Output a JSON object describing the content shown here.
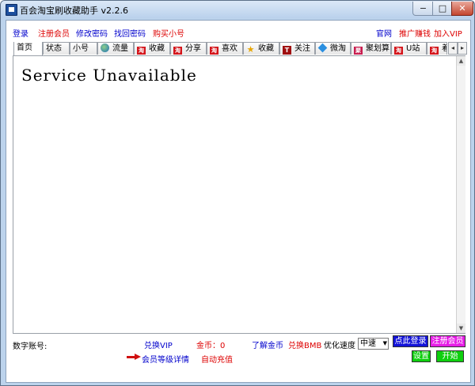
{
  "window": {
    "title": "百会淘宝刷收藏助手 v2.2.6",
    "controls": {
      "minimize": "−",
      "maximize": "□",
      "close": "✕"
    }
  },
  "menu": {
    "left": [
      {
        "label": "登录",
        "color": "blue"
      },
      {
        "label": "注册会员",
        "color": "red"
      },
      {
        "label": "修改密码",
        "color": "blue"
      },
      {
        "label": "找回密码",
        "color": "blue"
      },
      {
        "label": "购买小号",
        "color": "red"
      }
    ],
    "right": [
      {
        "label": "官网",
        "color": "blue"
      },
      {
        "label": "推广赚钱",
        "color": "red"
      },
      {
        "label": "加入VIP",
        "color": "red"
      }
    ]
  },
  "tabs": [
    {
      "label": "首页",
      "icon": "none",
      "active": true
    },
    {
      "label": "状态",
      "icon": "none"
    },
    {
      "label": "小号",
      "icon": "none"
    },
    {
      "label": "流量",
      "icon": "globe-icon"
    },
    {
      "label": "收藏",
      "icon": "taobao-icon"
    },
    {
      "label": "分享",
      "icon": "taobao-icon"
    },
    {
      "label": "喜欢",
      "icon": "taobao-icon"
    },
    {
      "label": "收藏",
      "icon": "star-icon"
    },
    {
      "label": "关注",
      "icon": "tmall-icon"
    },
    {
      "label": "微淘",
      "icon": "diamond-icon"
    },
    {
      "label": "聚划算",
      "icon": "juhuasuan-icon"
    },
    {
      "label": "U站",
      "icon": "taobao-icon"
    },
    {
      "label": "着",
      "icon": "taobao-icon"
    }
  ],
  "tab_scroll": {
    "left": "◂",
    "right": "▸"
  },
  "content": {
    "message": "Service Unavailable"
  },
  "bottom": {
    "account_label": "数字账号:",
    "exchange_vip": "兑换VIP",
    "gold_label": "金币：0",
    "learn_gold": "了解金币",
    "exchange_bmb": "兑换BMB",
    "speed_label": "优化速度",
    "speed_value": "中速",
    "login_button": "点此登录",
    "register_button": "注册会员",
    "member_level": "会员等级详情",
    "auto_recharge": "自动充值",
    "settings_button": "设置",
    "start_button": "开始"
  },
  "colors": {
    "link_blue": "#0000cc",
    "link_red": "#dd0000",
    "login_button_bg": "#1313d8",
    "register_button_bg": "#e61ee6",
    "action_button_bg": "#0ecf0e"
  }
}
